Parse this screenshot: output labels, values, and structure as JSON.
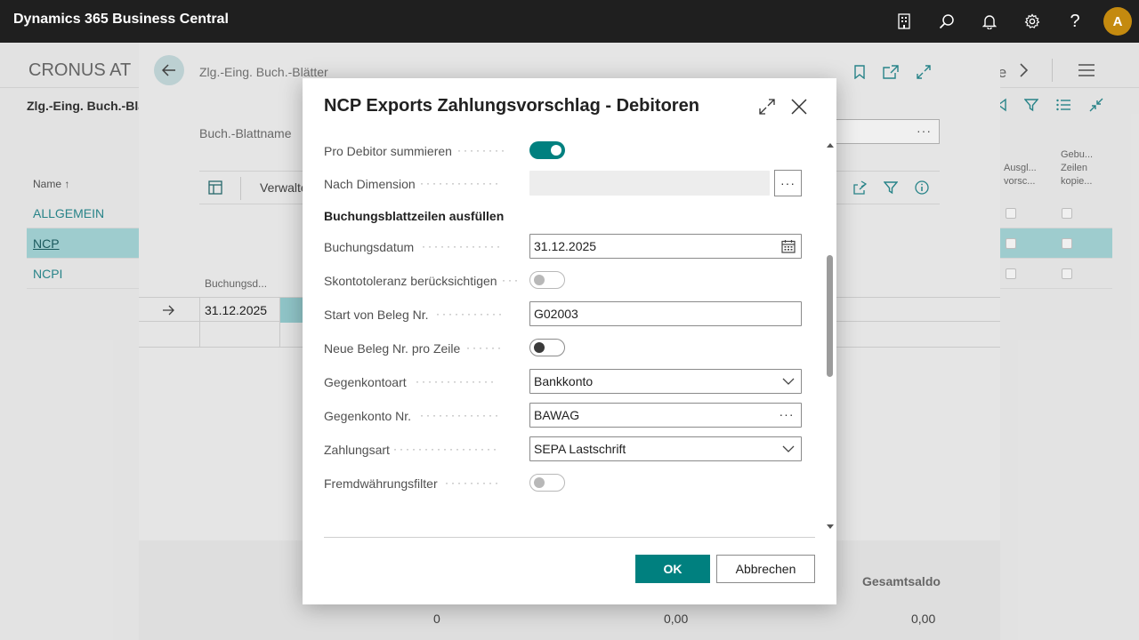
{
  "app": {
    "title": "Dynamics 365 Business Central",
    "user_initial": "A"
  },
  "appbar_icons": [
    "company-icon",
    "search-icon",
    "bell-icon",
    "gear-icon",
    "help-icon"
  ],
  "background": {
    "company": "CRONUS AT",
    "page_title": "Zlg.-Eing. Buch.-Blätt",
    "list_header": "Name ↑",
    "rows": [
      "ALLGEMEIN",
      "NCP",
      "NCPI"
    ],
    "selected_row": "NCP",
    "right_nav_text": "le",
    "right_col1": [
      "Ausgl...",
      "vorsc..."
    ],
    "right_col2": [
      "Gebu...",
      "Zeilen",
      "kopie..."
    ]
  },
  "journal": {
    "breadcrumb": "Zlg.-Eing. Buch.-Blätter",
    "batch_label": "Buch.-Blattname",
    "toolbar_label": "Verwalte",
    "column_header": "Buchungsd...",
    "row_date": "31.12.2025",
    "footer_label": "Gesamtsaldo",
    "footer_values": [
      "0",
      "0,00",
      "0,00"
    ]
  },
  "dialog": {
    "title": "NCP Exports Zahlungsvorschlag - Debitoren",
    "fields": {
      "pro_debitor": {
        "label": "Pro Debitor summieren",
        "value": true
      },
      "nach_dimension": {
        "label": "Nach Dimension",
        "value": ""
      },
      "section": "Buchungsblattzeilen ausfüllen",
      "buchungsdatum": {
        "label": "Buchungsdatum",
        "value": "31.12.2025"
      },
      "skonto": {
        "label": "Skontotoleranz berücksichtigen",
        "value": false
      },
      "start_beleg": {
        "label": "Start von Beleg Nr.",
        "value": "G02003"
      },
      "neue_beleg": {
        "label": "Neue Beleg Nr. pro Zeile",
        "value": false
      },
      "gegenkontoart": {
        "label": "Gegenkontoart",
        "value": "Bankkonto"
      },
      "gegenkonto_nr": {
        "label": "Gegenkonto Nr.",
        "value": "BAWAG"
      },
      "zahlungsart": {
        "label": "Zahlungsart",
        "value": "SEPA Lastschrift"
      },
      "fremdwaehrung": {
        "label": "Fremdwährungsfilter",
        "value": false
      }
    },
    "buttons": {
      "ok": "OK",
      "cancel": "Abbrechen"
    },
    "assist_glyph": "···",
    "colors": {
      "accent": "#00807f",
      "selected_row": "#a8d9db"
    }
  }
}
